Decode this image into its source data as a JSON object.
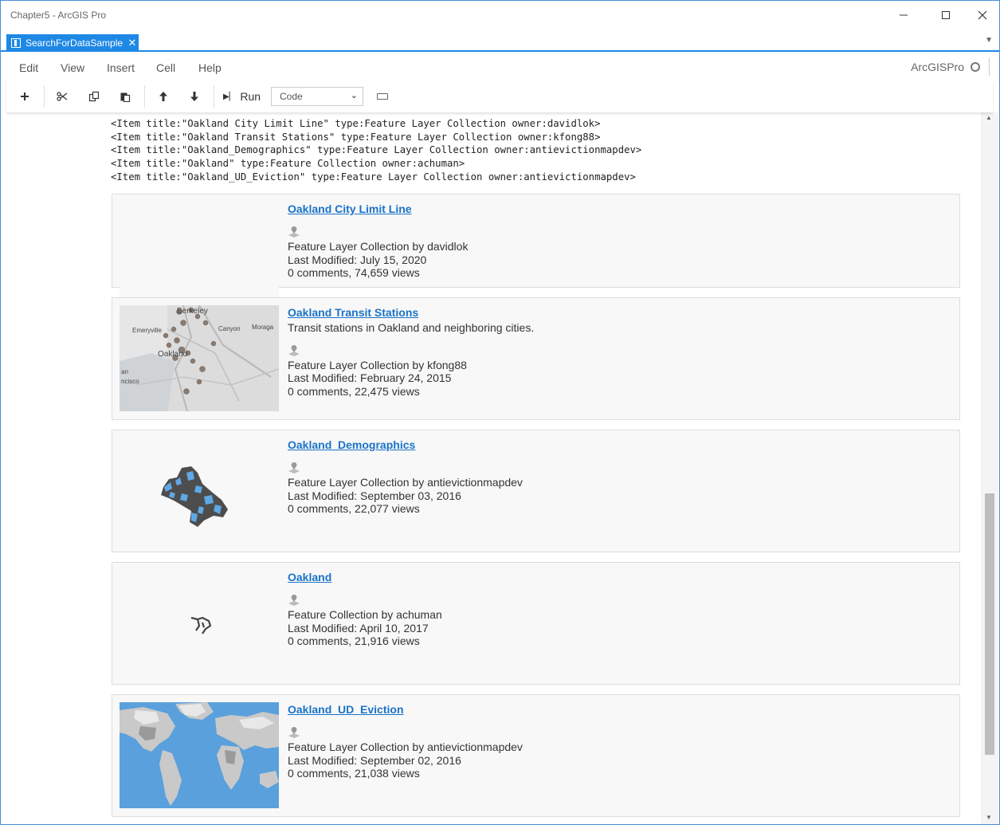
{
  "window": {
    "title": "Chapter5 - ArcGIS Pro",
    "minimize_icon": "minimize-icon",
    "maximize_icon": "maximize-icon",
    "close_icon": "close-icon"
  },
  "tabs": [
    {
      "label": "SearchForDataSample",
      "close": "✕",
      "active": true
    }
  ],
  "menu": [
    "Edit",
    "View",
    "Insert",
    "Cell",
    "Help"
  ],
  "kernel": {
    "name": "ArcGISPro"
  },
  "toolbar": {
    "run_label": "Run",
    "cell_type": "Code",
    "cell_type_options": [
      "Code"
    ],
    "icons": [
      "plus-icon",
      "cut-icon",
      "copy-icon",
      "paste-icon",
      "move-up-icon",
      "move-down-icon",
      "run-icon",
      "keyboard-icon"
    ]
  },
  "output_lines": [
    "<Item title:\"Oakland City Limit Line\" type:Feature Layer Collection owner:davidlok>",
    "<Item title:\"Oakland Transit Stations\" type:Feature Layer Collection owner:kfong88>",
    "<Item title:\"Oakland_Demographics\" type:Feature Layer Collection owner:antievictionmapdev>",
    "<Item title:\"Oakland\" type:Feature Collection owner:achuman>",
    "<Item title:\"Oakland_UD_Eviction\" type:Feature Layer Collection owner:antievictionmapdev>"
  ],
  "items": [
    {
      "title": "Oakland City Limit Line",
      "snippet": "",
      "type_line": "Feature Layer Collection by davidlok",
      "modified": "Last Modified: July 15, 2020",
      "stats": "0 comments, 74,659 views",
      "thumbnail": "none"
    },
    {
      "title": "Oakland Transit Stations",
      "snippet": "Transit stations in Oakland and neighboring cities.",
      "type_line": "Feature Layer Collection by kfong88",
      "modified": "Last Modified: February 24, 2015",
      "stats": "0 comments, 22,475 views",
      "thumbnail": "map",
      "map_labels": [
        "Berkeley",
        "Emeryville",
        "Canyon",
        "Moraga",
        "Oakland",
        "an",
        "ncisco"
      ]
    },
    {
      "title": "Oakland_Demographics",
      "snippet": "",
      "type_line": "Feature Layer Collection by antievictionmapdev",
      "modified": "Last Modified: September 03, 2016",
      "stats": "0 comments, 22,077 views",
      "thumbnail": "demographics"
    },
    {
      "title": "Oakland",
      "snippet": "",
      "type_line": "Feature Collection by achuman",
      "modified": "Last Modified: April 10, 2017",
      "stats": "0 comments, 21,916 views",
      "thumbnail": "outline"
    },
    {
      "title": "Oakland_UD_Eviction",
      "snippet": "",
      "type_line": "Feature Layer Collection by antievictionmapdev",
      "modified": "Last Modified: September 02, 2016",
      "stats": "0 comments, 21,038 views",
      "thumbnail": "world"
    }
  ],
  "colors": {
    "accent": "#1e88e5",
    "link": "#1a73c8"
  }
}
